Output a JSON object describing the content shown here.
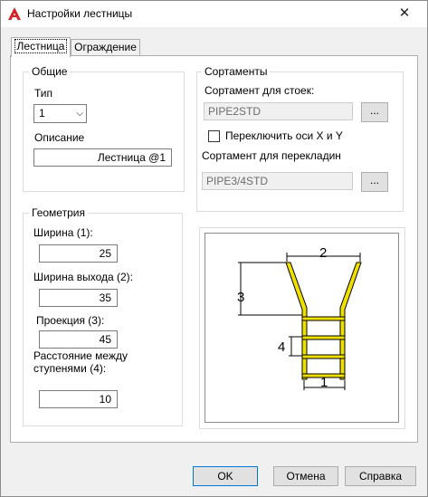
{
  "window": {
    "title": "Настройки лестницы",
    "close_glyph": "✕"
  },
  "tabs": [
    {
      "label": "Лестница"
    },
    {
      "label": "Ограждение"
    }
  ],
  "general": {
    "group_label": "Общие",
    "type_label": "Тип",
    "type_value": "1",
    "description_label": "Описание",
    "description_value": "Лестница @1"
  },
  "profiles": {
    "group_label": "Сортаменты",
    "post_label": "Сортамент для стоек:",
    "post_value": "PIPE2STD",
    "swap_axes_label": "Переключить оси X и Y",
    "swap_axes_checked": false,
    "rung_label": "Сортамент для перекладин",
    "rung_value": "PIPE3/4STD",
    "browse_label": "..."
  },
  "geometry": {
    "group_label": "Геометрия",
    "width_label": "Ширина (1):",
    "width_value": "25",
    "exit_width_label": "Ширина выхода (2):",
    "exit_width_value": "35",
    "projection_label": "Проекция (3):",
    "projection_value": "45",
    "step_spacing_label": "Расстояние между ступенями (4):",
    "step_spacing_value": "10"
  },
  "diagram": {
    "label_1": "1",
    "label_2": "2",
    "label_3": "3",
    "label_4": "4",
    "rail_color": "#f0e000"
  },
  "buttons": {
    "ok": "OK",
    "cancel": "Отмена",
    "help": "Справка"
  },
  "colors": {
    "accent": "#0078d7",
    "app_icon": "#d6242b"
  },
  "icons": {
    "app": "autocad-logo-icon",
    "close": "close-icon",
    "dropdown": "chevron-down-icon"
  }
}
